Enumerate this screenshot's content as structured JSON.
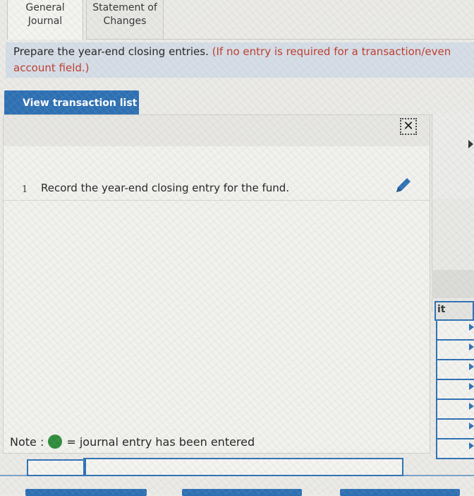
{
  "tabs": [
    {
      "line1": "General",
      "line2": "Journal"
    },
    {
      "line1": "Statement of",
      "line2": "Changes"
    }
  ],
  "instruction": {
    "text": "Prepare the year-end closing entries.",
    "note_line1": "(If no entry is required for a transaction/even",
    "note_line2": "account field.)"
  },
  "view_button": {
    "label": "View transaction list"
  },
  "close_icon": {
    "glyph": "✕"
  },
  "transactions": [
    {
      "number": "1",
      "description": "Record the year-end closing entry for the fund."
    }
  ],
  "note": {
    "prefix": "Note :",
    "suffix": "= journal entry has been entered",
    "dot_color": "#2e8b3a"
  },
  "right_table": {
    "header_fragment": "it"
  },
  "colors": {
    "accent": "#2d6fb3",
    "instruction_bg": "#d6dde6",
    "note_red": "#c0392b"
  }
}
